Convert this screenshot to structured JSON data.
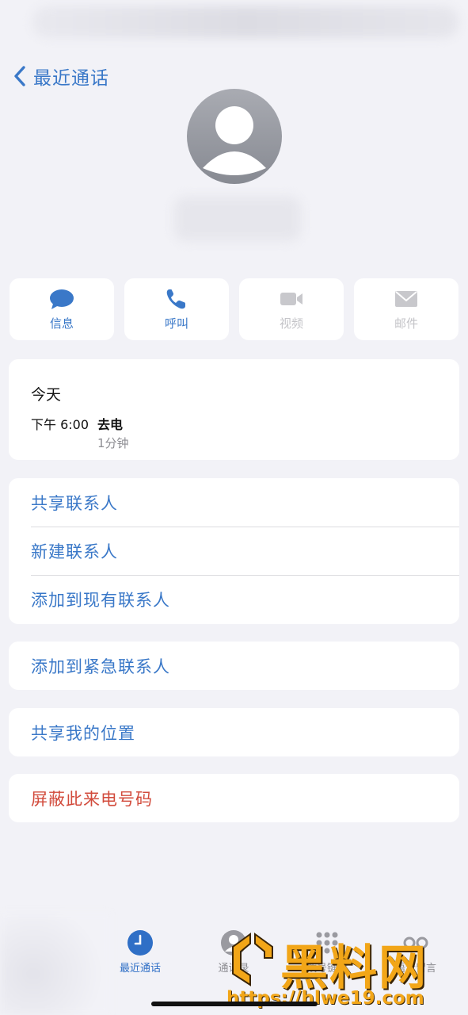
{
  "nav": {
    "back_label": "最近通话"
  },
  "actions": [
    {
      "label": "信息",
      "icon": "message-icon",
      "enabled": true
    },
    {
      "label": "呼叫",
      "icon": "phone-icon",
      "enabled": true
    },
    {
      "label": "视频",
      "icon": "video-icon",
      "enabled": false
    },
    {
      "label": "邮件",
      "icon": "mail-icon",
      "enabled": false
    }
  ],
  "recent_call": {
    "day": "今天",
    "time": "下午 6:00",
    "type": "去电",
    "duration": "1分钟"
  },
  "contact_options": [
    {
      "label": "共享联系人"
    },
    {
      "label": "新建联系人"
    },
    {
      "label": "添加到现有联系人"
    }
  ],
  "emergency": {
    "label": "添加到紧急联系人"
  },
  "location": {
    "label": "共享我的位置"
  },
  "block": {
    "label": "屏蔽此来电号码"
  },
  "tabbar": {
    "items": [
      {
        "label": "最近通话",
        "icon": "clock-icon",
        "active": true
      },
      {
        "label": "通讯录",
        "icon": "contacts-icon",
        "active": false
      },
      {
        "label": "拨号键盘",
        "icon": "keypad-icon",
        "active": false
      },
      {
        "label": "语音留言",
        "icon": "voicemail-icon",
        "active": false
      }
    ]
  },
  "watermark": {
    "title": "黑料网",
    "url": "https://hlwe19.com"
  },
  "colors": {
    "accent": "#3a78c8",
    "danger": "#d24b3c",
    "background": "#f2f2f7",
    "watermark": "#f2a618"
  }
}
